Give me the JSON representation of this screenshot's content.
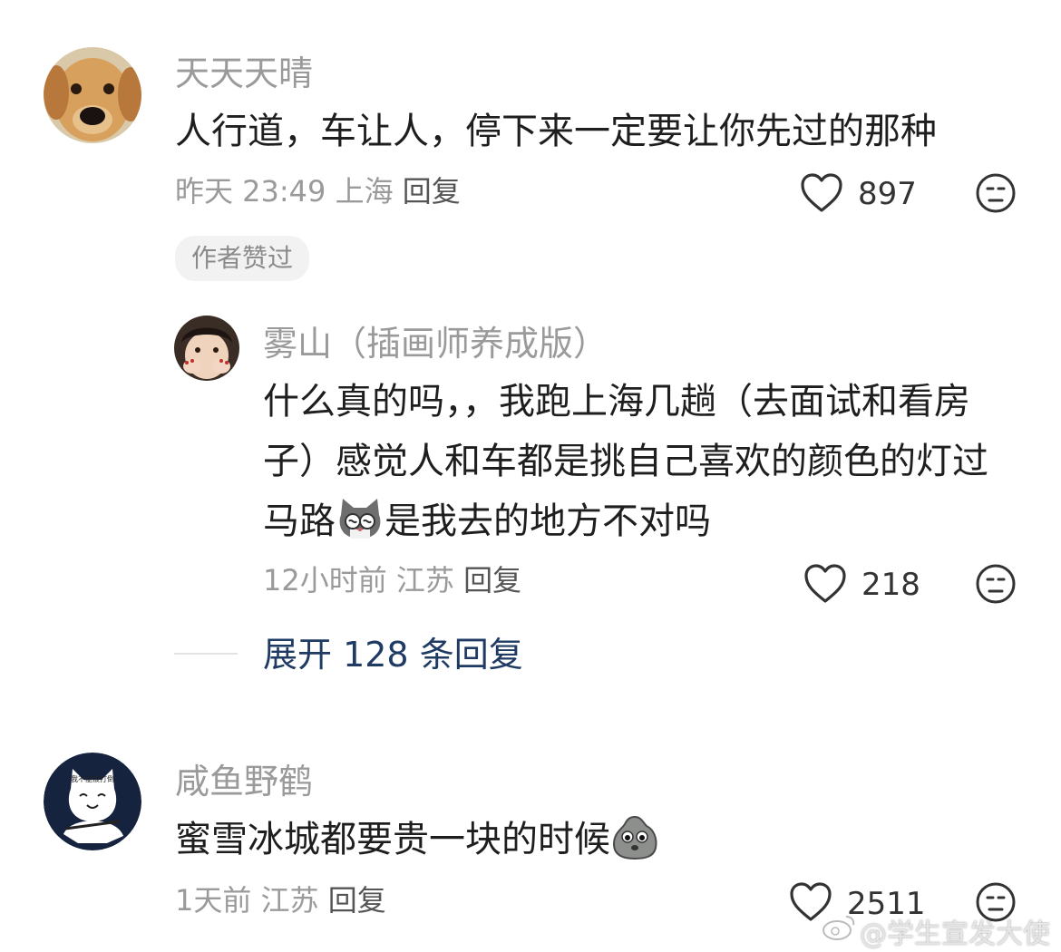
{
  "comments": [
    {
      "username": "天天天晴",
      "text": "人行道，车让人，停下来一定要让你先过的那种",
      "time": "昨天 23:49",
      "location": "上海",
      "reply_label": "回复",
      "likes": "897",
      "badge": "作者赞过",
      "avatar_icon": "golden-retriever-avatar",
      "sub_reply": {
        "username": "雾山（插画师养成版）",
        "text_line1": "什么真的吗，，我跑上海几趟（去面试和看房",
        "text_line2": "子）感觉人和车都是挑自己喜欢的颜色的灯过",
        "text_line3a": "马路",
        "text_line3b": "是我去的地方不对吗",
        "time": "12小时前",
        "location": "江苏",
        "reply_label": "回复",
        "likes": "218",
        "avatar_icon": "girl-covering-face-avatar",
        "emoji_icon": "cat-dizzy-emoji"
      },
      "expand_label": "展开 128 条回复"
    },
    {
      "username": "咸鱼野鹤",
      "text": "蜜雪冰城都要贵一块的时候",
      "time": "1天前",
      "location": "江苏",
      "reply_label": "回复",
      "likes": "2511",
      "avatar_icon": "cartoon-cat-avatar",
      "avatar_caption": "我不能被打倒",
      "emoji_icon": "sad-potato-emoji"
    }
  ],
  "watermark": "@学生宣发大使",
  "colors": {
    "meta": "#9a9a9a",
    "expand_link": "#1f3b64",
    "badge_bg": "#f2f2f2"
  }
}
